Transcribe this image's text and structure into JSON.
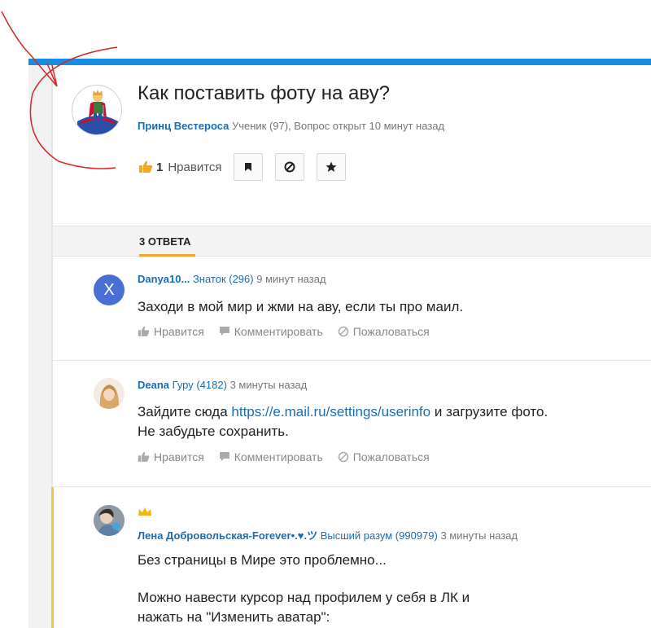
{
  "question": {
    "title": "Как поставить фоту на аву?",
    "author": "Принц Вестероса",
    "meta_rest": " Ученик (97), Вопрос открыт 10 минут назад",
    "like_count": "1",
    "like_label": "Нравится"
  },
  "answers_header": {
    "tab_label": "3 ОТВЕТА"
  },
  "answers": [
    {
      "avatar_letter": "X",
      "author": "Danya10...",
      "rank": " Знаток (296)",
      "time": " 9 минут назад",
      "text_line1": "Заходи в мой мир и жми на аву, если ты про маил."
    },
    {
      "author": "Deana",
      "rank": " Гуру (4182)",
      "time": " 3 минуты назад",
      "text_before_link": "Зайдите сюда ",
      "link": "https://e.mail.ru/settings/userinfo",
      "text_after_link": " и загрузите фото.",
      "text_line2": "Не забудьте сохранить."
    },
    {
      "author": "Лена Добровольская-Forever•.♥.ツ",
      "rank": " Высший разум (990979)",
      "time": " 3 минуты назад",
      "text_line1": "Без страницы в Мире это проблемно...",
      "text_line2": "Можно навести курсор над профилем у себя в ЛК и",
      "text_line3": "нажать на \"Изменить аватар\":"
    }
  ],
  "answer_actions": {
    "like": "Нравится",
    "comment": "Комментировать",
    "report": "Пожаловаться"
  },
  "colors": {
    "accent_blue": "#168de2",
    "link_blue": "#1a6db3",
    "tab_orange": "#f5a623",
    "annotation_red": "#d42a2a"
  }
}
